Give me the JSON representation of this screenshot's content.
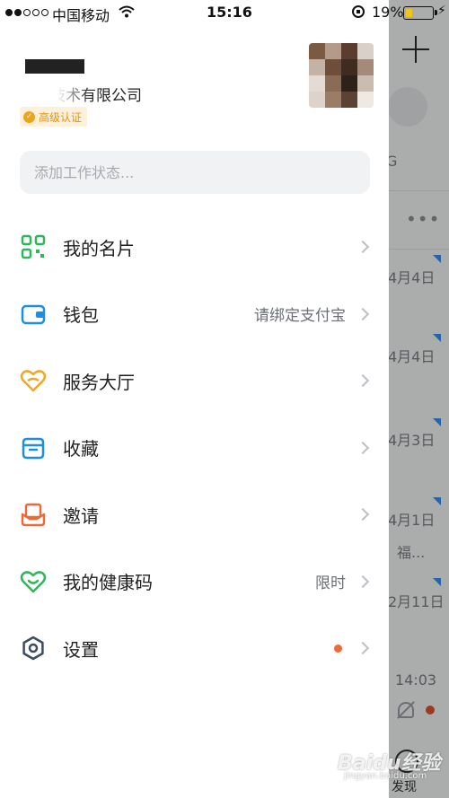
{
  "status_bar": {
    "carrier": "中国移动",
    "time": "15:16",
    "battery_percent": "19%",
    "battery_level": 0.19,
    "signal_bars": 2,
    "icons": [
      "signal-icon",
      "wifi-icon",
      "rotation-lock-icon",
      "battery-icon",
      "charging-icon"
    ]
  },
  "profile": {
    "company": "信息技术有限公司",
    "badge": "高级认证",
    "badge_color": "#f0a21c"
  },
  "status_input": {
    "placeholder": "添加工作状态...",
    "value": ""
  },
  "menu": {
    "items": [
      {
        "label": "我的名片",
        "icon": "qr-code-icon",
        "right_text": "",
        "color": "#2fb55a"
      },
      {
        "label": "钱包",
        "icon": "wallet-icon",
        "right_text": "请绑定支付宝",
        "color": "#1e8fe0"
      },
      {
        "label": "服务大厅",
        "icon": "heart-hands-icon",
        "right_text": "",
        "color": "#f2a623"
      },
      {
        "label": "收藏",
        "icon": "folder-icon",
        "right_text": "",
        "color": "#1e8fe0"
      },
      {
        "label": "邀请",
        "icon": "invite-icon",
        "right_text": "",
        "color": "#ec6a37"
      },
      {
        "label": "我的健康码",
        "icon": "health-code-icon",
        "right_text": "限时",
        "color": "#2fb55a"
      },
      {
        "label": "设置",
        "icon": "gear-icon",
        "right_text": "",
        "color": "#3b4d66",
        "has_dot": true
      }
    ]
  },
  "background": {
    "dates": [
      "4月4日",
      "4月4日",
      "4月3日",
      "4月1日",
      "2月11日"
    ],
    "snippet": "福...",
    "time": "14:03",
    "letter": "G",
    "tab": "发现"
  },
  "watermark": {
    "brand": "Baidu经验",
    "url": "jingyan.baidu.com"
  }
}
